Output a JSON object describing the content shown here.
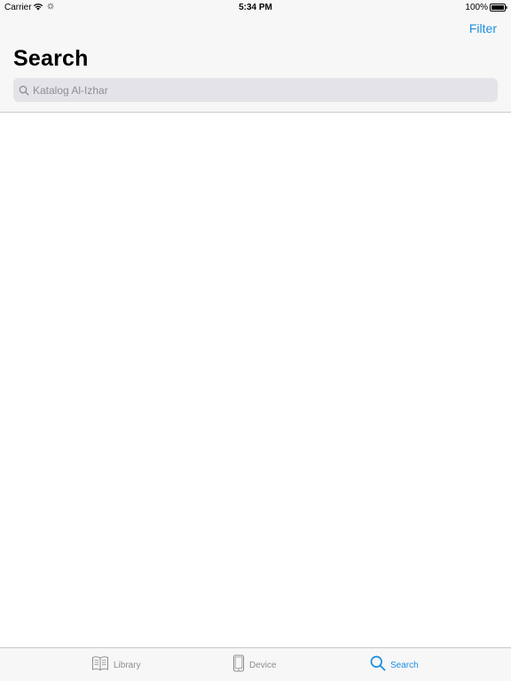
{
  "status_bar": {
    "carrier": "Carrier",
    "time": "5:34 PM",
    "battery_percent": "100%",
    "icons": [
      "wifi-icon",
      "activity-icon",
      "battery-icon"
    ]
  },
  "nav": {
    "filter_label": "Filter",
    "title": "Search"
  },
  "search": {
    "placeholder": "Katalog Al-Izhar",
    "value": ""
  },
  "tab_bar": {
    "tabs": [
      {
        "label": "Library",
        "icon": "book-icon",
        "selected": false
      },
      {
        "label": "Device",
        "icon": "device-icon",
        "selected": false
      },
      {
        "label": "Search",
        "icon": "search-icon",
        "selected": true
      }
    ]
  },
  "colors": {
    "accent": "#1a8ee0",
    "inactive": "#8e8e93",
    "bar_background": "#f7f7f7",
    "search_field": "#e3e3e8"
  }
}
